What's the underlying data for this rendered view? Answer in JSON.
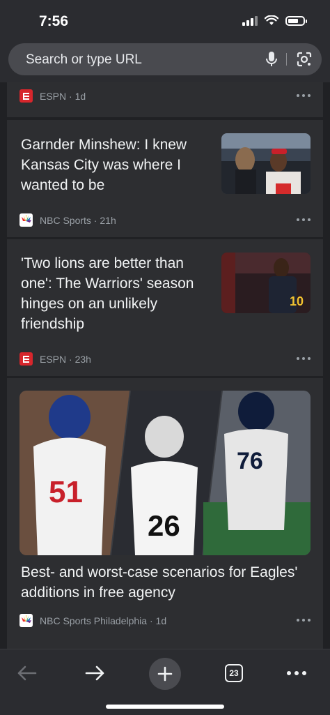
{
  "status": {
    "time": "7:56"
  },
  "search": {
    "placeholder": "Search or type URL"
  },
  "feed": {
    "top_card": {
      "source": "ESPN",
      "age": "1d"
    },
    "articles": [
      {
        "headline": "Garnder Minshew: I knew Kansas City was where I wanted to be",
        "source": "NBC Sports",
        "age": "21h"
      },
      {
        "headline": "'Two lions are better than one': The Warriors' season hinges on an unlikely friendship",
        "source": "ESPN",
        "age": "23h"
      },
      {
        "headline": "Best- and worst-case scenarios for Eagles' additions in free agency",
        "source": "NBC Sports Philadelphia",
        "age": "1d"
      }
    ]
  },
  "bottom_bar": {
    "tab_count": "23"
  },
  "icons": [
    "mic-icon",
    "lens-icon",
    "back-arrow-icon",
    "forward-arrow-icon",
    "new-tab-plus-icon",
    "tab-switcher-icon",
    "menu-dots-icon"
  ]
}
